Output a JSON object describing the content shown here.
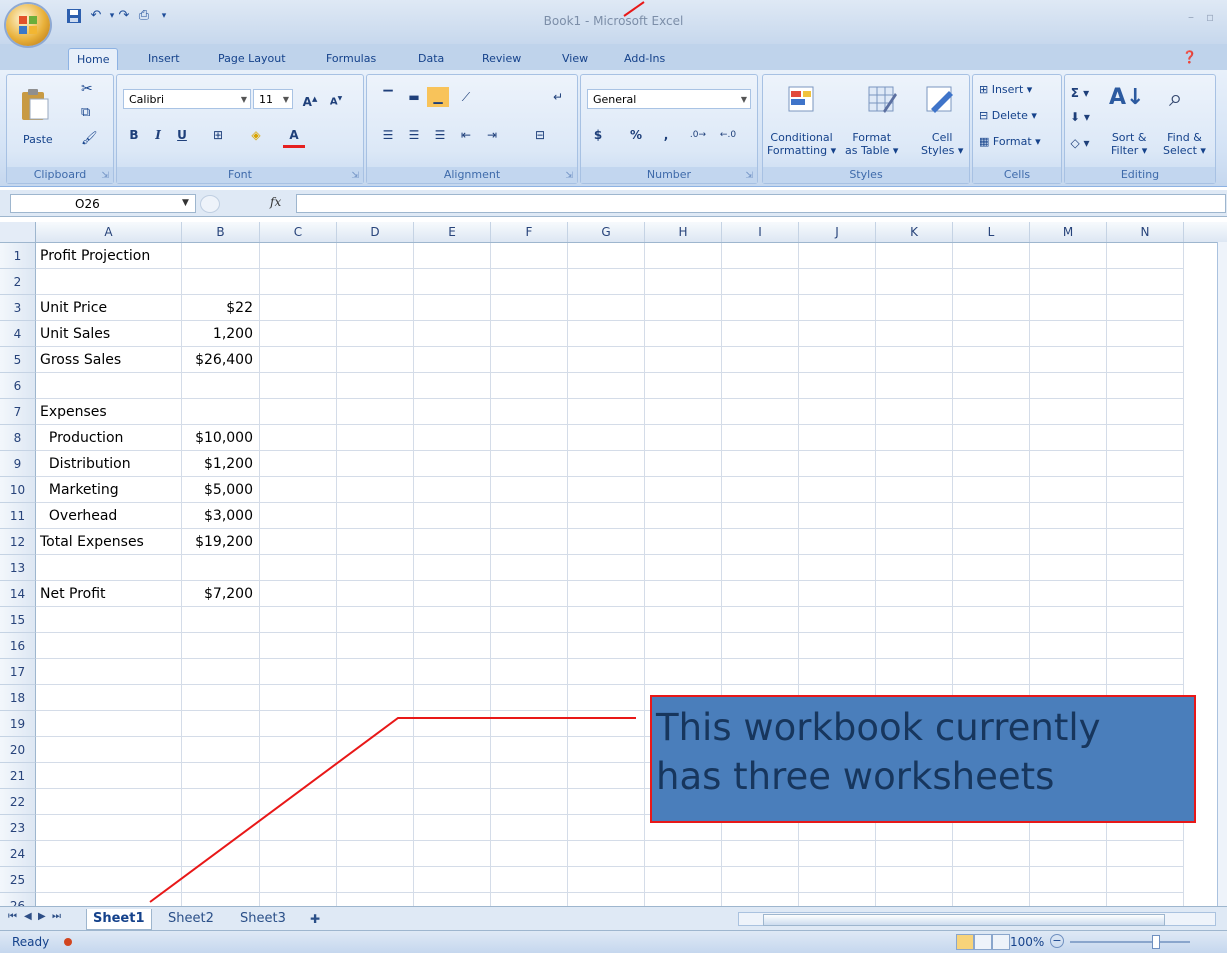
{
  "window": {
    "title": "Book1 - Microsoft Excel"
  },
  "ribbon": {
    "tabs": [
      "Home",
      "Insert",
      "Page Layout",
      "Formulas",
      "Data",
      "Review",
      "View",
      "Add-Ins"
    ],
    "active_tab": "Home",
    "clipboard": {
      "label": "Clipboard",
      "paste": "Paste"
    },
    "font": {
      "label": "Font",
      "name": "Calibri",
      "size": "11"
    },
    "alignment": {
      "label": "Alignment"
    },
    "number": {
      "label": "Number",
      "format": "General"
    },
    "styles": {
      "label": "Styles",
      "conditional_1": "Conditional",
      "conditional_2": "Formatting ▾",
      "format_table_1": "Format",
      "format_table_2": "as Table ▾",
      "cell_styles_1": "Cell",
      "cell_styles_2": "Styles ▾"
    },
    "cells": {
      "label": "Cells",
      "insert": "Insert ▾",
      "delete": "Delete ▾",
      "format": "Format ▾"
    },
    "editing": {
      "label": "Editing",
      "sort_1": "Sort &",
      "sort_2": "Filter ▾",
      "find_1": "Find &",
      "find_2": "Select ▾"
    }
  },
  "formula_bar": {
    "name_box": "O26",
    "fx": "fx",
    "value": ""
  },
  "columns": [
    "A",
    "B",
    "C",
    "D",
    "E",
    "F",
    "G",
    "H",
    "I",
    "J",
    "K",
    "L",
    "M",
    "N"
  ],
  "rows": [
    {
      "n": "1",
      "a": "Profit Projection",
      "b": ""
    },
    {
      "n": "2",
      "a": "",
      "b": ""
    },
    {
      "n": "3",
      "a": "Unit Price",
      "b": "$22"
    },
    {
      "n": "4",
      "a": "Unit Sales",
      "b": "1,200"
    },
    {
      "n": "5",
      "a": "Gross Sales",
      "b": "$26,400"
    },
    {
      "n": "6",
      "a": "",
      "b": ""
    },
    {
      "n": "7",
      "a": "Expenses",
      "b": ""
    },
    {
      "n": "8",
      "a": "  Production",
      "b": "$10,000"
    },
    {
      "n": "9",
      "a": "  Distribution",
      "b": "$1,200"
    },
    {
      "n": "10",
      "a": "  Marketing",
      "b": "$5,000"
    },
    {
      "n": "11",
      "a": "  Overhead",
      "b": "$3,000"
    },
    {
      "n": "12",
      "a": "Total Expenses",
      "b": "$19,200"
    },
    {
      "n": "13",
      "a": "",
      "b": ""
    },
    {
      "n": "14",
      "a": "Net Profit",
      "b": "$7,200"
    },
    {
      "n": "15",
      "a": "",
      "b": ""
    },
    {
      "n": "16",
      "a": "",
      "b": ""
    },
    {
      "n": "17",
      "a": "",
      "b": ""
    },
    {
      "n": "18",
      "a": "",
      "b": ""
    },
    {
      "n": "19",
      "a": "",
      "b": ""
    },
    {
      "n": "20",
      "a": "",
      "b": ""
    },
    {
      "n": "21",
      "a": "",
      "b": ""
    },
    {
      "n": "22",
      "a": "",
      "b": ""
    },
    {
      "n": "23",
      "a": "",
      "b": ""
    },
    {
      "n": "24",
      "a": "",
      "b": ""
    },
    {
      "n": "25",
      "a": "",
      "b": ""
    },
    {
      "n": "26",
      "a": "",
      "b": ""
    }
  ],
  "sheets": [
    "Sheet1",
    "Sheet2",
    "Sheet3"
  ],
  "active_sheet": "Sheet1",
  "status": {
    "ready": "Ready",
    "zoom": "100%"
  },
  "callout": {
    "line1": "This workbook currently",
    "line2": "has three worksheets"
  },
  "colors": {
    "callout_fill": "#4a7ebb",
    "callout_border": "#e81818",
    "callout_text": "#17365d",
    "leader_line": "#e81818"
  }
}
